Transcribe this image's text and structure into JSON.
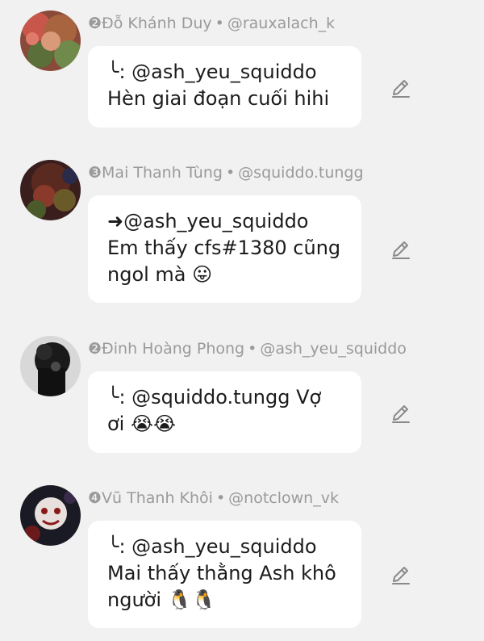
{
  "comments": [
    {
      "rank_name": "❷Đỗ Khánh Duy",
      "separator": "•",
      "handle": "@rauxalach_k",
      "lines": [
        "╰: @ash_yeu_squiddo",
        "Hèn giai đoạn cuối hihi"
      ],
      "avatar_icon": "avatar-red-green-art"
    },
    {
      "rank_name": "❸Mai Thanh Tùng",
      "separator": "•",
      "handle": "@squiddo.tungg",
      "lines": [
        "➜@ash_yeu_squiddo",
        "Em thấy cfs#1380 cũng",
        "ngol mà 😛"
      ],
      "avatar_icon": "avatar-dark-red-art"
    },
    {
      "rank_name": "❷Đinh Hoàng Phong",
      "separator": "•",
      "handle": "@ash_yeu_squiddo",
      "lines": [
        "╰: @squiddo.tungg Vợ",
        "ơi 😭😭"
      ],
      "avatar_icon": "avatar-black-white-art"
    },
    {
      "rank_name": "❹Vũ Thanh Khôi",
      "separator": "•",
      "handle": "@notclown_vk",
      "lines": [
        "╰: @ash_yeu_squiddo",
        "Mai thấy thằng Ash khô",
        "người 🐧🐧"
      ],
      "avatar_icon": "avatar-dark-red-clown-art"
    }
  ],
  "edit_icon": "pencil-icon"
}
